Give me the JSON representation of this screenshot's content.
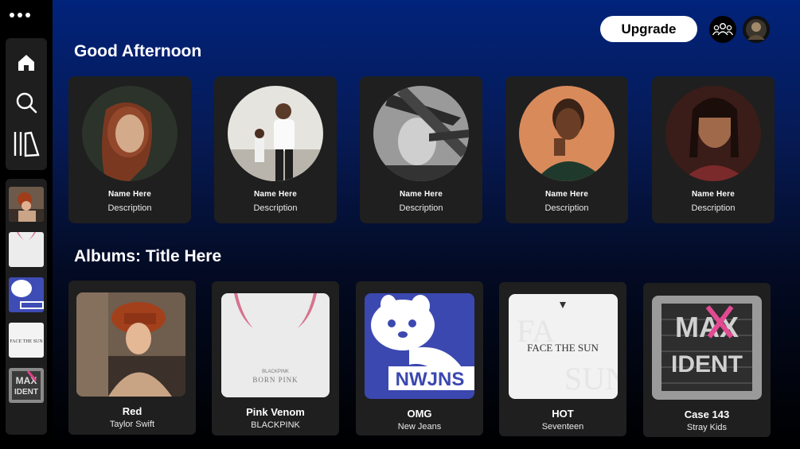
{
  "sidebar": {
    "menu_icon": "more-dots-icon",
    "nav": [
      {
        "name": "home",
        "icon": "home-icon"
      },
      {
        "name": "search",
        "icon": "search-icon"
      },
      {
        "name": "library",
        "icon": "library-icon"
      }
    ],
    "library_items": [
      "Red",
      "Pink Venom",
      "OMG",
      "HOT",
      "Case 143"
    ]
  },
  "header": {
    "upgrade_label": "Upgrade",
    "friends_icon": "friends-icon",
    "profile_icon": "avatar"
  },
  "greeting": "Good Afternoon",
  "artists": [
    {
      "name": "Name Here",
      "description": "Description"
    },
    {
      "name": "Name Here",
      "description": "Description"
    },
    {
      "name": "Name Here",
      "description": "Description"
    },
    {
      "name": "Name Here",
      "description": "Description"
    },
    {
      "name": "Name Here",
      "description": "Description"
    }
  ],
  "albums_title": "Albums: Title Here",
  "albums": [
    {
      "title": "Red",
      "artist": "Taylor Swift"
    },
    {
      "title": "Pink Venom",
      "artist": "BLACKPINK",
      "cover_text": [
        "BLACKPINK",
        "BORN PINK"
      ]
    },
    {
      "title": "OMG",
      "artist": "New Jeans",
      "cover_text": [
        "NWJNS"
      ]
    },
    {
      "title": "HOT",
      "artist": "Seventeen",
      "cover_text": [
        "FACE THE SUN"
      ]
    },
    {
      "title": "Case 143",
      "artist": "Stray Kids",
      "cover_text": [
        "MAX",
        "IDENT"
      ]
    }
  ],
  "colors": {
    "accent_bg_top": "#02237b",
    "card_bg": "#1f1f1f",
    "sidebar_panel": "#1e1e1e"
  }
}
